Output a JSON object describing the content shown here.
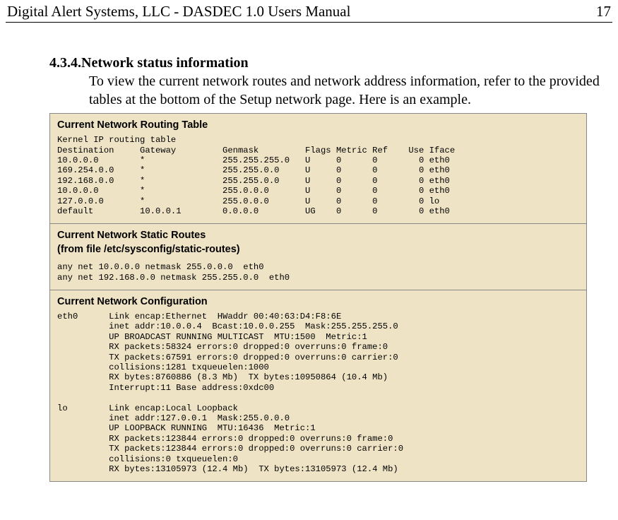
{
  "header": {
    "left": "Digital Alert Systems, LLC - DASDEC 1.0 Users Manual",
    "right": "17"
  },
  "section": {
    "number": "4.3.4.",
    "title": "Network status information",
    "body": "To view the current network routes and network address information, refer to the provided tables at the bottom of the Setup network page. Here is an example."
  },
  "panel1": {
    "title": "Current Network Routing Table",
    "text": "Kernel IP routing table\nDestination     Gateway         Genmask         Flags Metric Ref    Use Iface\n10.0.0.0        *               255.255.255.0   U     0      0        0 eth0\n169.254.0.0     *               255.255.0.0     U     0      0        0 eth0\n192.168.0.0     *               255.255.0.0     U     0      0        0 eth0\n10.0.0.0        *               255.0.0.0       U     0      0        0 eth0\n127.0.0.0       *               255.0.0.0       U     0      0        0 lo\ndefault         10.0.0.1        0.0.0.0         UG    0      0        0 eth0"
  },
  "panel2": {
    "title": "Current Network Static Routes",
    "subtitle": " (from file /etc/sysconfig/static-routes)",
    "text": "any net 10.0.0.0 netmask 255.0.0.0  eth0\nany net 192.168.0.0 netmask 255.255.0.0  eth0"
  },
  "panel3": {
    "title": "Current Network Configuration",
    "text": "eth0      Link encap:Ethernet  HWaddr 00:40:63:D4:F8:6E\n          inet addr:10.0.0.4  Bcast:10.0.0.255  Mask:255.255.255.0\n          UP BROADCAST RUNNING MULTICAST  MTU:1500  Metric:1\n          RX packets:58324 errors:0 dropped:0 overruns:0 frame:0\n          TX packets:67591 errors:0 dropped:0 overruns:0 carrier:0\n          collisions:1281 txqueuelen:1000\n          RX bytes:8760886 (8.3 Mb)  TX bytes:10950864 (10.4 Mb)\n          Interrupt:11 Base address:0xdc00\n\nlo        Link encap:Local Loopback\n          inet addr:127.0.0.1  Mask:255.0.0.0\n          UP LOOPBACK RUNNING  MTU:16436  Metric:1\n          RX packets:123844 errors:0 dropped:0 overruns:0 frame:0\n          TX packets:123844 errors:0 dropped:0 overruns:0 carrier:0\n          collisions:0 txqueuelen:0\n          RX bytes:13105973 (12.4 Mb)  TX bytes:13105973 (12.4 Mb)\n"
  }
}
